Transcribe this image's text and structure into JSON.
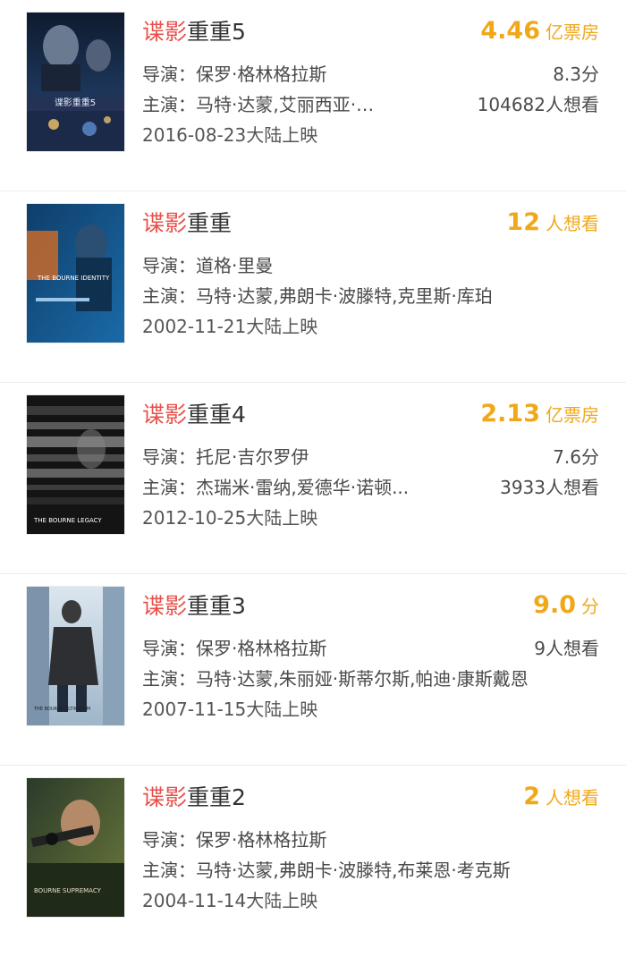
{
  "movies": [
    {
      "title_kw": "谍影",
      "title_rest": "重重5",
      "stat_num": "4.46",
      "stat_unit": "亿票房",
      "director": "导演：保罗·格林格拉斯",
      "cast": "主演：马特·达蒙,艾丽西亚·…",
      "release": "2016-08-23大陆上映",
      "right1": "8.3分",
      "right2": "104682人想看",
      "poster_caption": "谍影重重5"
    },
    {
      "title_kw": "谍影",
      "title_rest": "重重",
      "stat_num": "12",
      "stat_unit": "人想看",
      "director": "导演：道格·里曼",
      "cast": "主演：马特·达蒙,弗朗卡·波滕特,克里斯·库珀",
      "release": "2002-11-21大陆上映",
      "right1": "",
      "right2": "",
      "poster_caption": "THE BOURNE IDENTITY"
    },
    {
      "title_kw": "谍影",
      "title_rest": "重重4",
      "stat_num": "2.13",
      "stat_unit": "亿票房",
      "director": "导演：托尼·吉尔罗伊",
      "cast": "主演：杰瑞米·雷纳,爱德华·诺顿...",
      "release": "2012-10-25大陆上映",
      "right1": "7.6分",
      "right2": "3933人想看",
      "poster_caption": "THE BOURNE LEGACY"
    },
    {
      "title_kw": "谍影",
      "title_rest": "重重3",
      "stat_num": "9.0",
      "stat_unit": "分",
      "director": "导演：保罗·格林格拉斯",
      "cast": "主演：马特·达蒙,朱丽娅·斯蒂尔斯,帕迪·康斯戴恩",
      "release": "2007-11-15大陆上映",
      "right1": "9人想看",
      "right2": "",
      "poster_caption": "THE BOURNE ULTIMATUM"
    },
    {
      "title_kw": "谍影",
      "title_rest": "重重2",
      "stat_num": "2",
      "stat_unit": "人想看",
      "director": "导演：保罗·格林格拉斯",
      "cast": "主演：马特·达蒙,弗朗卡·波滕特,布莱恩·考克斯",
      "release": "2004-11-14大陆上映",
      "right1": "",
      "right2": "",
      "poster_caption": "BOURNE SUPREMACY"
    }
  ],
  "colors": {
    "keyword": "#e8504a",
    "stat": "#f0a81a"
  }
}
